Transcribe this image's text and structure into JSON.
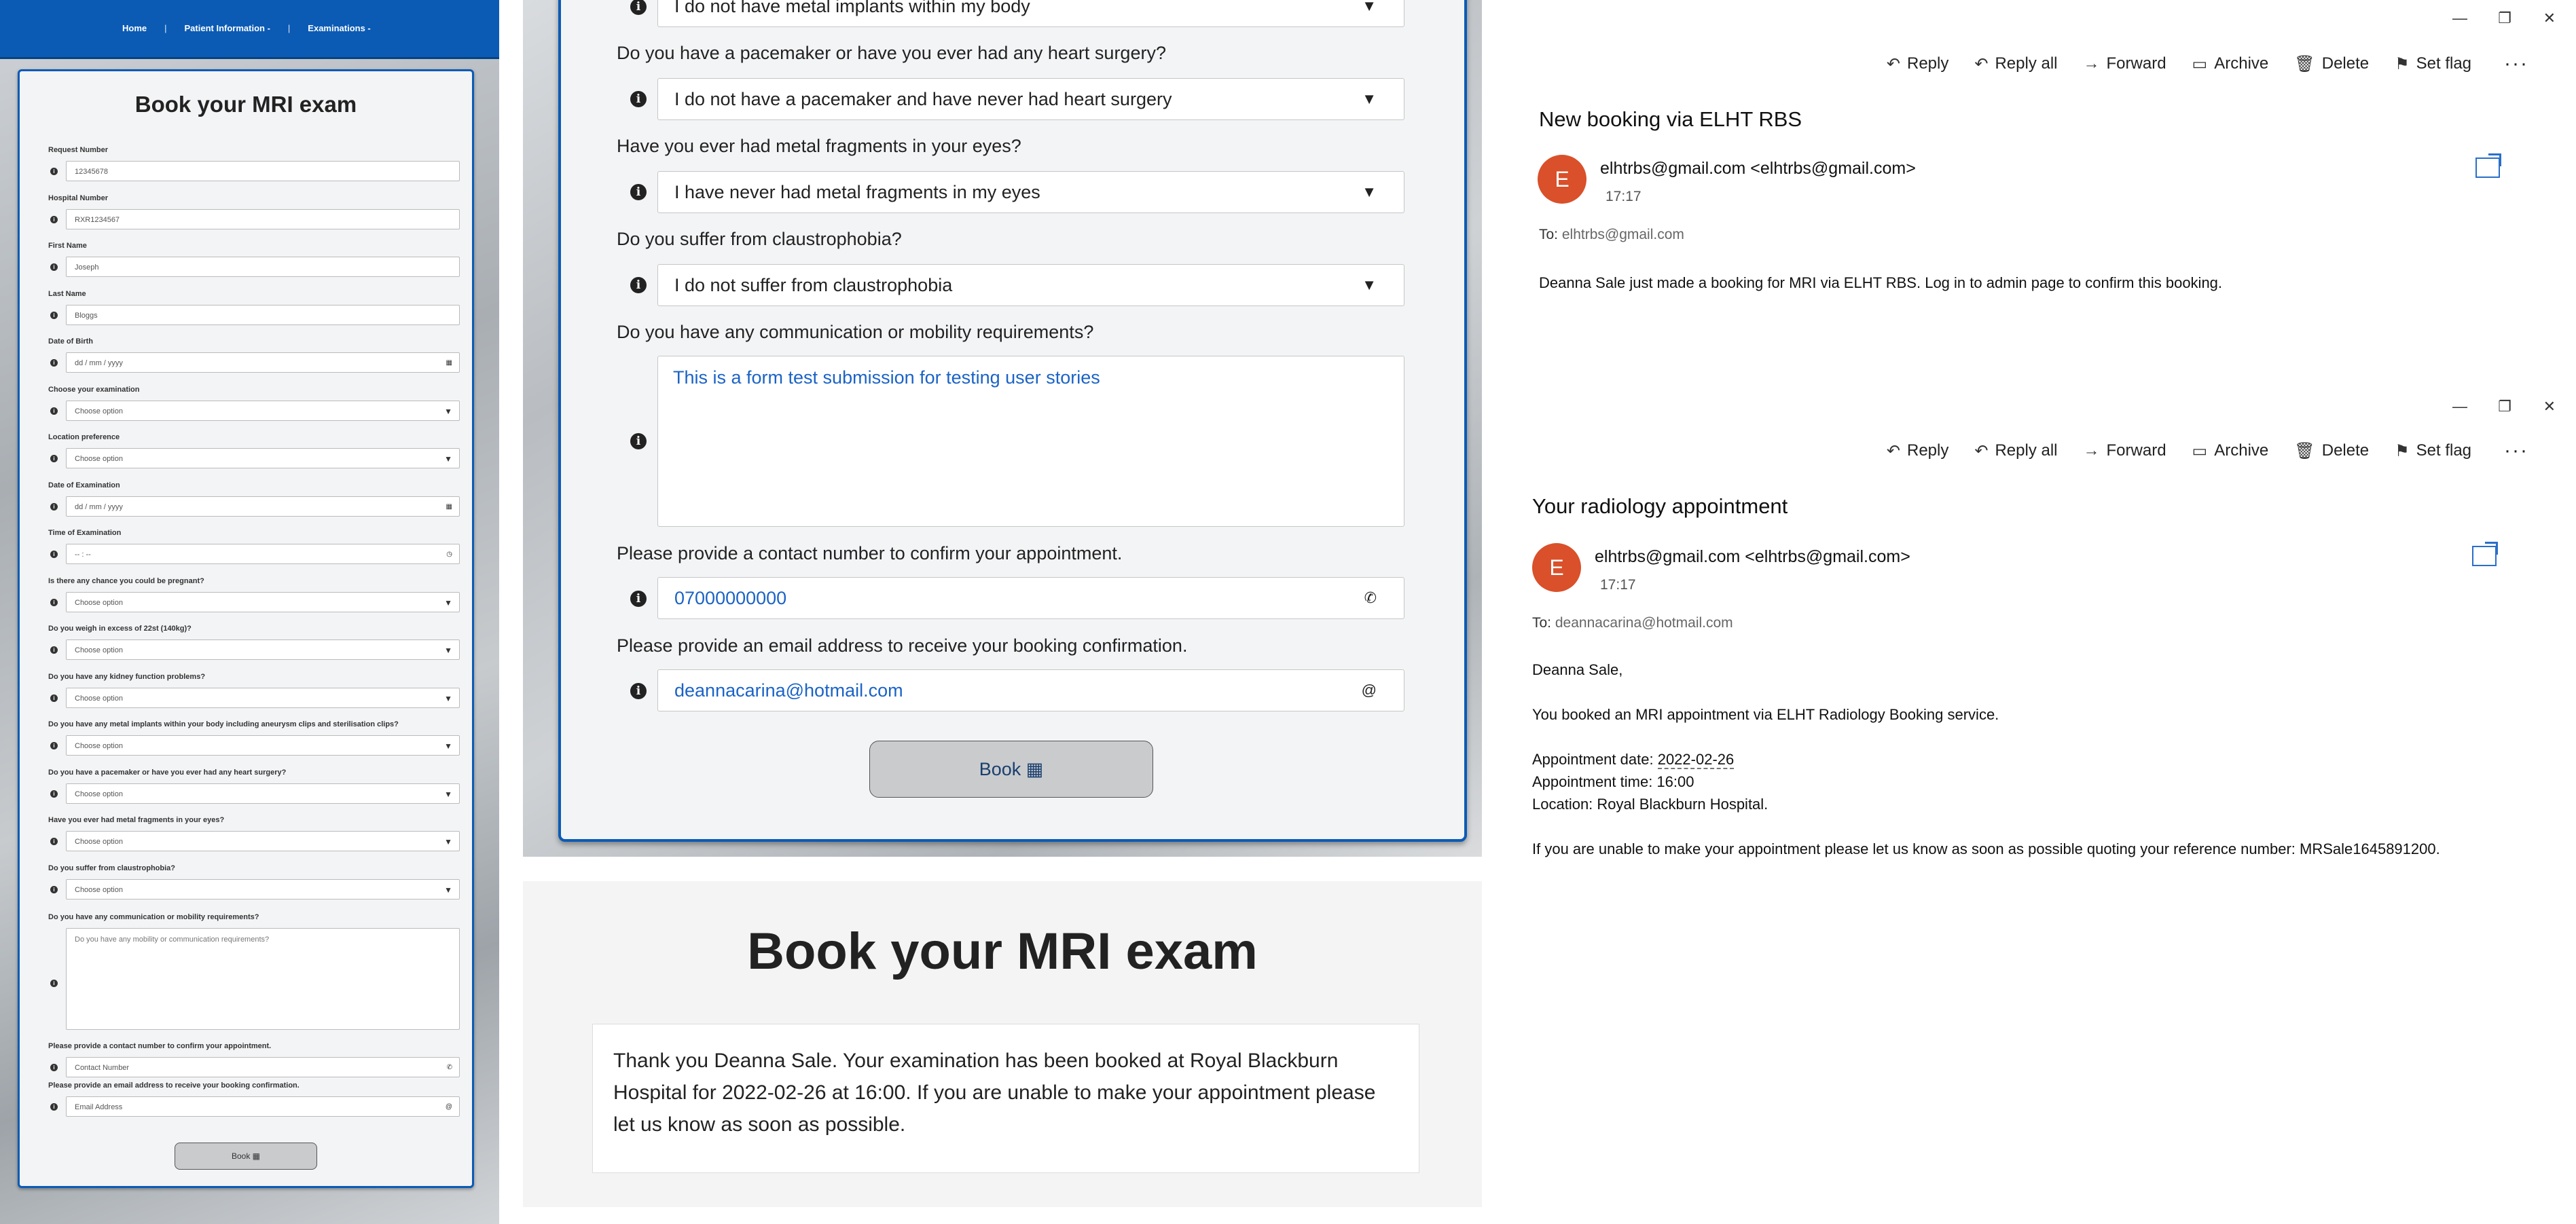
{
  "panel1": {
    "nav": [
      "Home",
      "Patient Information -",
      "Examinations -"
    ],
    "title": "Book your MRI exam",
    "fields": [
      {
        "label": "Request Number",
        "value": "12345678",
        "kind": "text"
      },
      {
        "label": "Hospital Number",
        "value": "RXR1234567",
        "kind": "text"
      },
      {
        "label": "First Name",
        "value": "Joseph",
        "kind": "text"
      },
      {
        "label": "Last Name",
        "value": "Bloggs",
        "kind": "text"
      },
      {
        "label": "Date of Birth",
        "value": "dd / mm / yyyy",
        "kind": "date"
      },
      {
        "label": "Choose your examination",
        "value": "Choose option",
        "kind": "select"
      },
      {
        "label": "Location preference",
        "value": "Choose option",
        "kind": "select"
      },
      {
        "label": "Date of Examination",
        "value": "dd / mm / yyyy",
        "kind": "date"
      },
      {
        "label": "Time of Examination",
        "value": "-- : --",
        "kind": "time"
      },
      {
        "label": "Is there any chance you could be pregnant?",
        "value": "Choose option",
        "kind": "select"
      },
      {
        "label": "Do you weigh in excess of 22st (140kg)?",
        "value": "Choose option",
        "kind": "select"
      },
      {
        "label": "Do you have any kidney function problems?",
        "value": "Choose option",
        "kind": "select"
      },
      {
        "label": "Do you have any metal implants within your body including aneurysm clips and sterilisation clips?",
        "value": "Choose option",
        "kind": "select"
      },
      {
        "label": "Do you have a pacemaker or have you ever had any heart surgery?",
        "value": "Choose option",
        "kind": "select"
      },
      {
        "label": "Have you ever had metal fragments in your eyes?",
        "value": "Choose option",
        "kind": "select"
      },
      {
        "label": "Do you suffer from claustrophobia?",
        "value": "Choose option",
        "kind": "select"
      }
    ],
    "textarea_label": "Do you have any communication or mobility requirements?",
    "textarea_placeholder": "Do you have any mobility or communication requirements?",
    "contact": {
      "label": "Please provide a contact number to confirm your appointment.",
      "placeholder": "Contact Number"
    },
    "email": {
      "label": "Please provide an email address to receive your booking confirmation.",
      "placeholder": "Email Address"
    },
    "book_label": "Book"
  },
  "panel2": {
    "rows": [
      {
        "question": "",
        "value": "I do not have metal implants within my body"
      },
      {
        "question": "Do you have a pacemaker or have you ever had any heart surgery?",
        "value": "I do not have a pacemaker and have never had heart surgery"
      },
      {
        "question": "Have you ever had metal fragments in your eyes?",
        "value": "I have never had metal fragments in my eyes"
      },
      {
        "question": "Do you suffer from claustrophobia?",
        "value": "I do not suffer from claustrophobia"
      }
    ],
    "comm_question": "Do you have any communication or mobility requirements?",
    "comm_value": "This is a form test submission for testing user stories",
    "contact_question": "Please provide a contact number to confirm your appointment.",
    "contact_value": "07000000000",
    "email_question": "Please provide an email address to receive your booking confirmation.",
    "email_value": "deannacarina@hotmail.com",
    "book_label": "Book",
    "confirm_title": "Book your MRI exam",
    "confirm_message": "Thank you Deanna Sale. Your examination has been booked at Royal Blackburn Hospital for 2022-02-26 at 16:00. If you are unable to make your appointment please let us know as soon as possible."
  },
  "email1": {
    "toolbar": [
      "Reply",
      "Reply all",
      "Forward",
      "Archive",
      "Delete",
      "Set flag"
    ],
    "subject": "New booking via ELHT RBS",
    "avatar": "E",
    "from": "elhtrbs@gmail.com <elhtrbs@gmail.com>",
    "time": "17:17",
    "to_label": "To:",
    "to": "elhtrbs@gmail.com",
    "body": "Deanna Sale just made a booking for MRI via ELHT RBS. Log in to admin page to confirm this booking."
  },
  "email2": {
    "toolbar": [
      "Reply",
      "Reply all",
      "Forward",
      "Archive",
      "Delete",
      "Set flag"
    ],
    "subject": "Your radiology appointment",
    "avatar": "E",
    "from": "elhtrbs@gmail.com <elhtrbs@gmail.com>",
    "time": "17:17",
    "to_label": "To:",
    "to": "deannacarina@hotmail.com",
    "greeting": "Deanna Sale,",
    "line1": "You booked an MRI appointment via ELHT Radiology Booking service.",
    "date_label": "Appointment date:",
    "date_value": "2022-02-26",
    "time_line": "Appointment time: 16:00",
    "location_line": "Location: Royal Blackburn Hospital.",
    "closing": "If you are unable to make your appointment please let us know as soon as possible quoting your reference number: MRSale1645891200."
  },
  "icons": {
    "info": "info-circle-icon",
    "chevron": "chevron-down-icon",
    "calendar": "calendar-icon",
    "clock": "clock-icon",
    "phone": "phone-icon",
    "at": "at-icon"
  },
  "colors": {
    "brand_blue": "#0b5bb5",
    "link_blue": "#1b63c6",
    "avatar": "#d9502a"
  }
}
